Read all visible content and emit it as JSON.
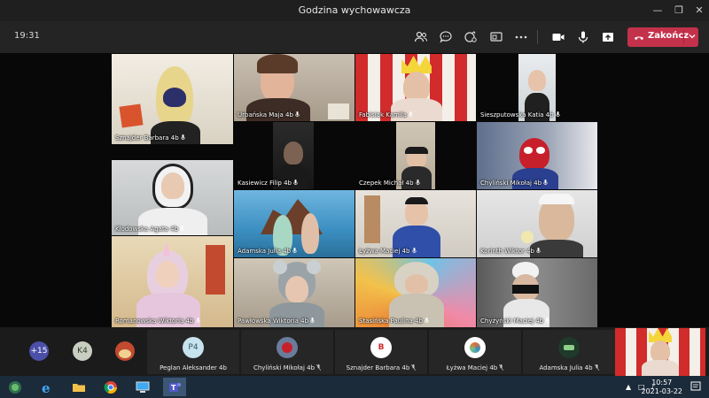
{
  "window": {
    "title": "Godzina wychowawcza"
  },
  "toolbar": {
    "timer": "19:31",
    "end_call_label": "Zakończ"
  },
  "tiles": [
    {
      "name": "Sznajder Barbara 4b"
    },
    {
      "name": "Urbańska Maja 4b"
    },
    {
      "name": "Fabisiak Kamila"
    },
    {
      "name": "Sieszputowska Katia 4b"
    },
    {
      "name": "Kasiewicz Filip 4b"
    },
    {
      "name": "Czepek Michał 4b"
    },
    {
      "name": "Chyliński Mikołaj 4b"
    },
    {
      "name": "Kłodowska Agata 4b"
    },
    {
      "name": "Adamska Julia 4b"
    },
    {
      "name": "Łyżwa Maciej 4b"
    },
    {
      "name": "Korinth Wiktor 4b"
    },
    {
      "name": "Romanowska Wiktoria 4b"
    },
    {
      "name": "Pawłowska Wiktoria 4b"
    },
    {
      "name": "Stasińska Paulina 4b"
    },
    {
      "name": "Chyżyński Maciej 4b"
    }
  ],
  "roster": {
    "overflow_count": "+15",
    "initials_avatar": "K4",
    "cards": [
      {
        "name": "Peglan Aleksander 4b",
        "initials": "P4"
      },
      {
        "name": "Chyliński Mikołaj 4b",
        "initials": ""
      },
      {
        "name": "Sznajder Barbara 4b",
        "initials": ""
      },
      {
        "name": "Łyżwa Maciej 4b",
        "initials": ""
      },
      {
        "name": "Adamska Julia 4b",
        "initials": ""
      }
    ]
  },
  "taskbar": {
    "time": "10:57",
    "date": "2021-03-22"
  },
  "colors": {
    "end_call": "#c4314b",
    "taskbar": "#1c2b3a",
    "roster_bg": "#1b1b1b"
  }
}
